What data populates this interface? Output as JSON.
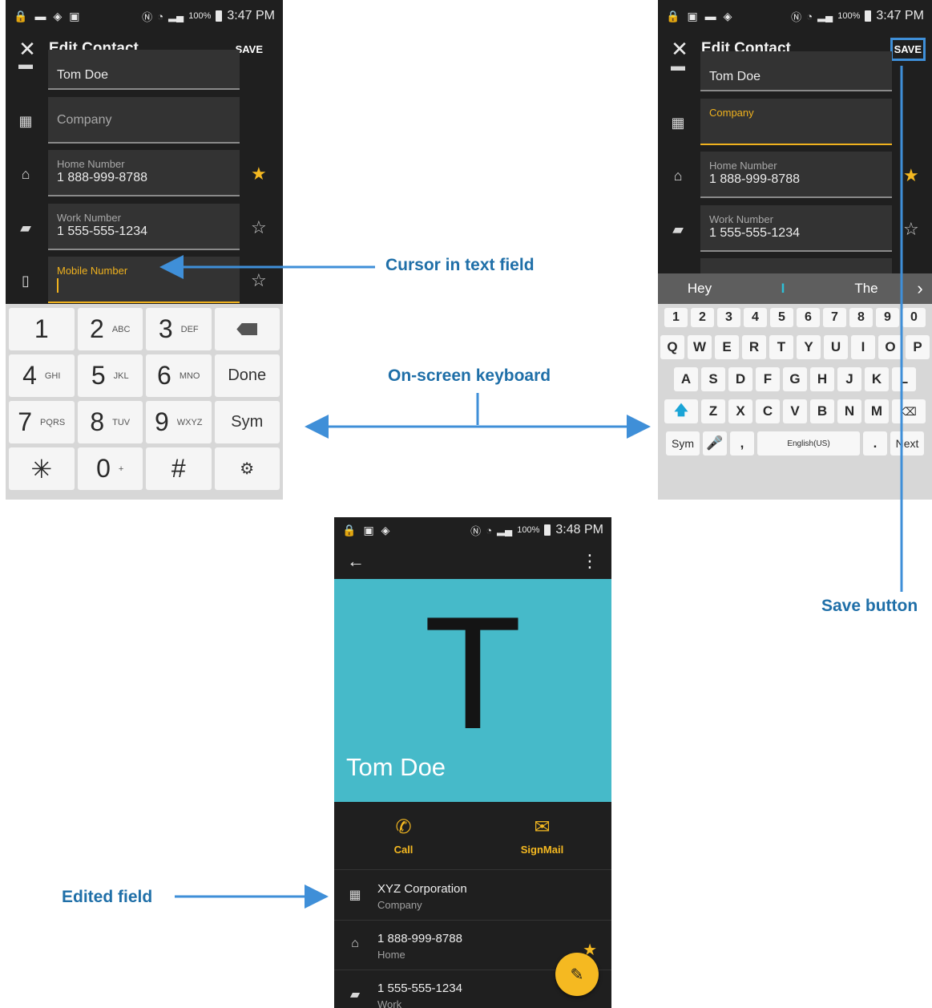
{
  "status_bars": {
    "left": {
      "battery": "100%",
      "time": "3:47 PM"
    },
    "right": {
      "battery": "100%",
      "time": "3:47 PM"
    },
    "bottom": {
      "battery": "100%",
      "time": "3:48 PM"
    }
  },
  "edit_screen": {
    "title": "Edit Contact",
    "save_label": "SAVE",
    "close_icon": "close-icon",
    "name_value": "Tom Doe",
    "company_placeholder": "Company",
    "company_label": "Company",
    "home_label": "Home Number",
    "home_value": "1 888-999-8788",
    "work_label": "Work Number",
    "work_value": "1 555-555-1234",
    "mobile_label": "Mobile Number"
  },
  "numpad": {
    "rows": [
      [
        {
          "big": "1",
          "small": ""
        },
        {
          "big": "2",
          "small": "ABC"
        },
        {
          "big": "3",
          "small": "DEF"
        },
        {
          "fn": "backspace"
        }
      ],
      [
        {
          "big": "4",
          "small": "GHI"
        },
        {
          "big": "5",
          "small": "JKL"
        },
        {
          "big": "6",
          "small": "MNO"
        },
        {
          "fn": "Done"
        }
      ],
      [
        {
          "big": "7",
          "small": "PQRS"
        },
        {
          "big": "8",
          "small": "TUV"
        },
        {
          "big": "9",
          "small": "WXYZ"
        },
        {
          "fn": "Sym"
        }
      ],
      [
        {
          "big": "✳",
          "small": ""
        },
        {
          "big": "0",
          "small": "+"
        },
        {
          "big": "#",
          "small": ""
        },
        {
          "fn": "settings"
        }
      ]
    ]
  },
  "qwerty": {
    "suggestions": [
      "Hey",
      "I",
      "The"
    ],
    "number_row": [
      "1",
      "2",
      "3",
      "4",
      "5",
      "6",
      "7",
      "8",
      "9",
      "0"
    ],
    "row1": [
      "Q",
      "W",
      "E",
      "R",
      "T",
      "Y",
      "U",
      "I",
      "O",
      "P"
    ],
    "row2": [
      "A",
      "S",
      "D",
      "F",
      "G",
      "H",
      "J",
      "K",
      "L"
    ],
    "row3": [
      "Z",
      "X",
      "C",
      "V",
      "B",
      "N",
      "M"
    ],
    "sym": "Sym",
    "comma": ",",
    "space_label": "English(US)",
    "period": ".",
    "next": "Next"
  },
  "contact_view": {
    "initial": "T",
    "name": "Tom Doe",
    "call_label": "Call",
    "signmail_label": "SignMail",
    "rows": [
      {
        "value": "XYZ Corporation",
        "label": "Company"
      },
      {
        "value": "1 888-999-8788",
        "label": "Home"
      },
      {
        "value": "1 555-555-1234",
        "label": "Work"
      }
    ]
  },
  "callouts": {
    "cursor": "Cursor in text field",
    "keyboard": "On-screen keyboard",
    "save": "Save button",
    "edited": "Edited field"
  },
  "colors": {
    "accent": "#f5b921",
    "hero": "#46bac9",
    "annotation": "#1f6fa8",
    "arrow": "#3f8fd8"
  }
}
